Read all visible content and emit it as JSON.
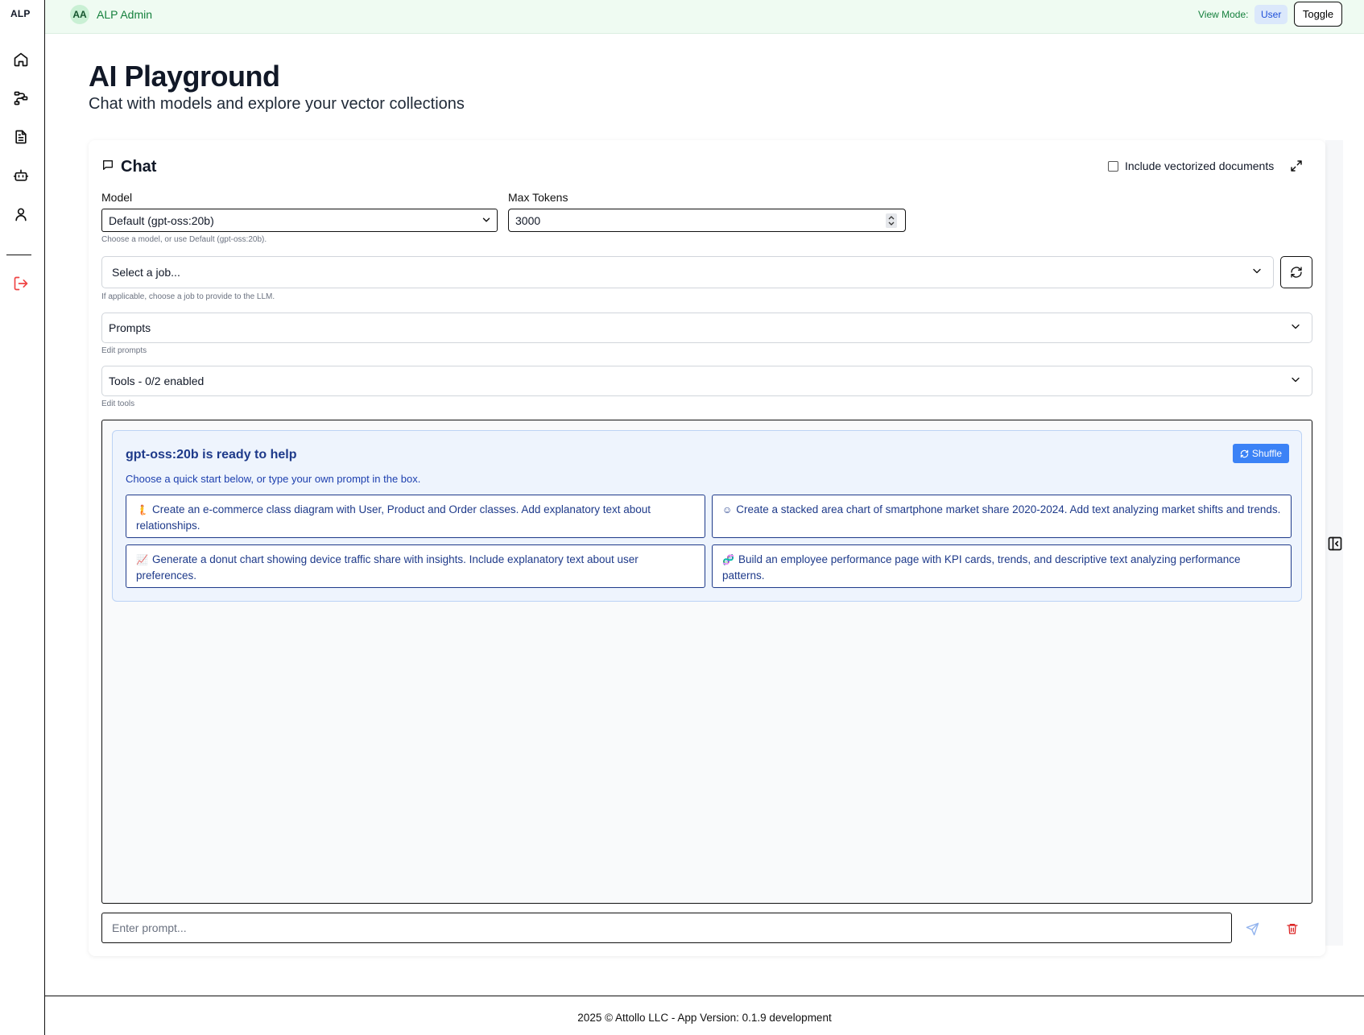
{
  "sidebar": {
    "brand": "ALP",
    "items": [
      {
        "icon": "home-icon"
      },
      {
        "icon": "workflow-icon"
      },
      {
        "icon": "document-icon"
      },
      {
        "icon": "bot-icon"
      },
      {
        "icon": "user-icon"
      }
    ],
    "logout_icon": "logout-icon",
    "logout_color": "#ef4444"
  },
  "topbar": {
    "avatar_initials": "AA",
    "user_name": "ALP Admin",
    "view_mode_label": "View Mode:",
    "view_mode_value": "User",
    "toggle_label": "Toggle",
    "accent": "#15803d",
    "background": "#effbf2"
  },
  "header": {
    "title": "AI Playground",
    "subtitle": "Chat with models and explore your vector collections"
  },
  "chat": {
    "title": "Chat",
    "include_vectorized_label": "Include vectorized documents",
    "include_vectorized_checked": false,
    "model": {
      "label": "Model",
      "value": "Default (gpt-oss:20b)",
      "help": "Choose a model, or use Default (gpt-oss:20b)."
    },
    "max_tokens": {
      "label": "Max Tokens",
      "value": "3000"
    },
    "job": {
      "placeholder": "Select a job...",
      "help": "If applicable, choose a job to provide to the LLM."
    },
    "prompts": {
      "label": "Prompts",
      "help": "Edit prompts"
    },
    "tools": {
      "label": "Tools - 0/2 enabled",
      "help": "Edit tools"
    },
    "welcome": {
      "title": "gpt-oss:20b is ready to help",
      "subtitle": "Choose a quick start below, or type your own prompt in the box.",
      "shuffle_label": "Shuffle",
      "quick_starts": [
        {
          "emoji": "🧜",
          "text": "Create an e-commerce class diagram with User, Product and Order classes. Add explanatory text about relationships."
        },
        {
          "emoji": "☺",
          "text": "Create a stacked area chart of smartphone market share 2020-2024. Add text analyzing market shifts and trends."
        },
        {
          "emoji": "📈",
          "text": "Generate a donut chart showing device traffic share with insights. Include explanatory text about user preferences."
        },
        {
          "emoji": "🧬",
          "text": "Build an employee performance page with KPI cards, trends, and descriptive text analyzing performance patterns."
        }
      ]
    },
    "input": {
      "placeholder": "Enter prompt..."
    },
    "colors": {
      "accent_blue": "#3b82f6",
      "welcome_text": "#1e3a8a",
      "delete_red": "#dc2626"
    }
  },
  "footer": {
    "text": "2025 © Attollo LLC - App Version: 0.1.9 development"
  }
}
